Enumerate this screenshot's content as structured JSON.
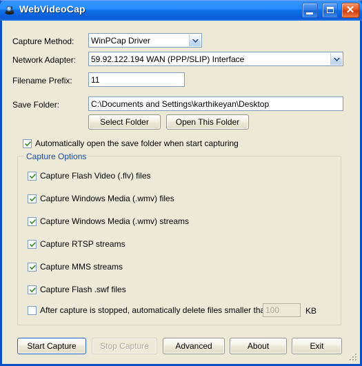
{
  "window": {
    "title": "WebVideoCap",
    "icon": "webcam-icon",
    "minimize_label": "Minimize",
    "maximize_label": "Maximize",
    "close_label": "Close"
  },
  "form": {
    "capture_method": {
      "label": "Capture Method:",
      "value": "WinPCap Driver"
    },
    "network_adapter": {
      "label": "Network Adapter:",
      "value": "59.92.122.194   WAN (PPP/SLIP) Interface"
    },
    "filename_prefix": {
      "label": "Filename Prefix:",
      "value": "11"
    },
    "save_folder": {
      "label": "Save Folder:",
      "value": "C:\\Documents and Settings\\karthikeyan\\Desktop"
    },
    "select_folder_button": "Select Folder",
    "open_this_folder_button": "Open This Folder",
    "auto_open": {
      "label": "Automatically open the save folder when start capturing",
      "checked": true
    }
  },
  "capture_options": {
    "title": "Capture Options",
    "items": [
      {
        "label": "Capture Flash Video (.flv) files",
        "checked": true
      },
      {
        "label": "Capture Windows Media (.wmv) files",
        "checked": true
      },
      {
        "label": "Capture Windows Media (.wmv) streams",
        "checked": true
      },
      {
        "label": "Capture RTSP streams",
        "checked": true
      },
      {
        "label": "Capture MMS streams",
        "checked": true
      },
      {
        "label": "Capture Flash .swf files",
        "checked": true
      }
    ],
    "delete_small": {
      "label": "After capture is stopped, automatically delete files smaller than:",
      "checked": false,
      "value": "100",
      "unit": "KB"
    }
  },
  "buttons": {
    "start_capture": "Start Capture",
    "stop_capture": "Stop Capture",
    "advanced": "Advanced",
    "about": "About",
    "exit": "Exit"
  },
  "colors": {
    "titlebar_blue": "#0058ee",
    "client_beige": "#ece9d8",
    "group_title_blue": "#1c4a9e",
    "check_green": "#3a8b2e",
    "disabled_gray": "#aca899"
  }
}
